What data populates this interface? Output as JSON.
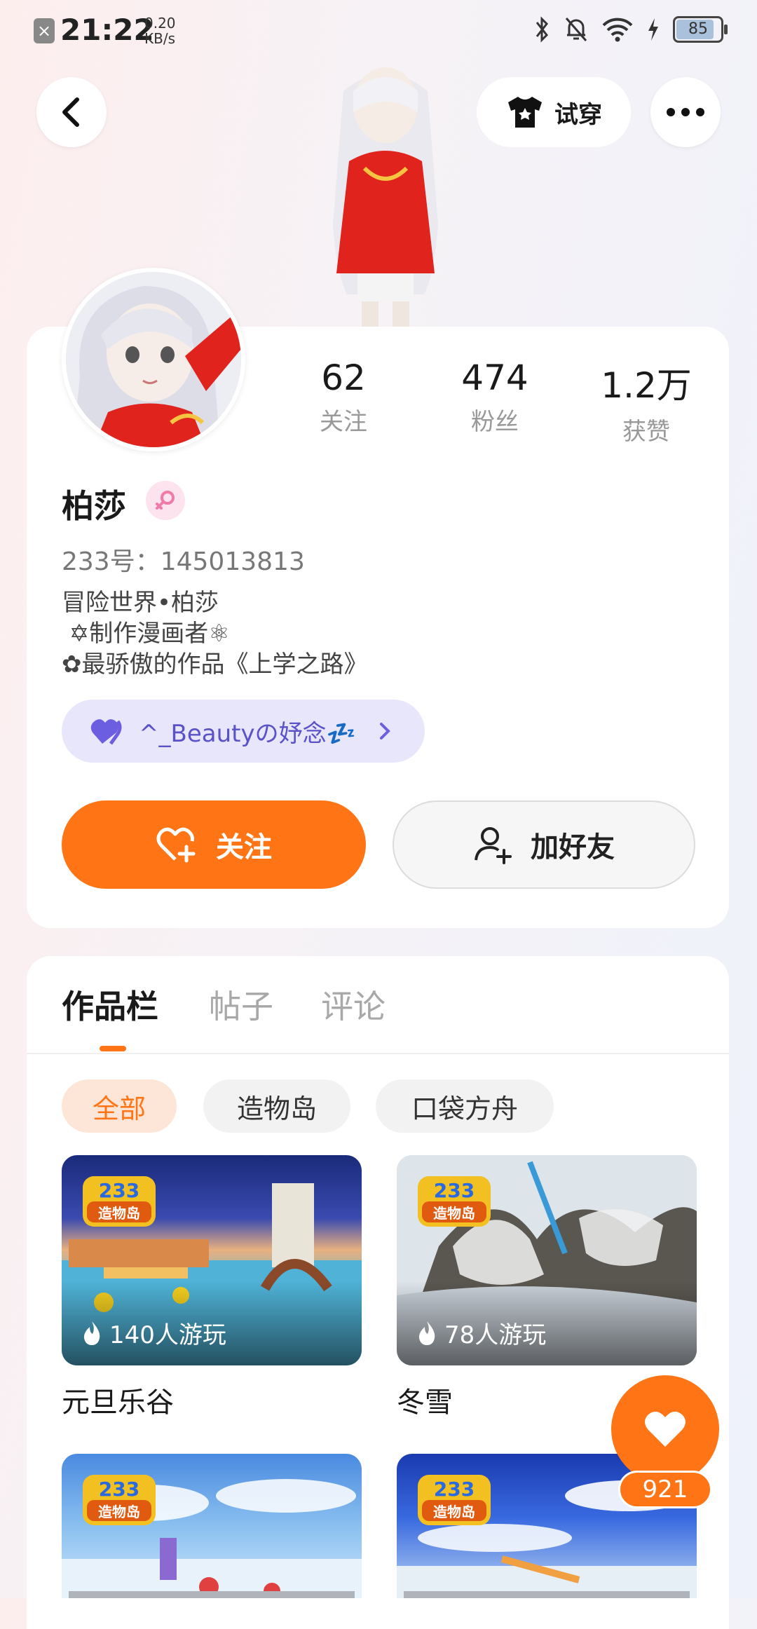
{
  "status_bar": {
    "time": "21:22",
    "net_rate_value": "0.20",
    "net_rate_unit": "KB/s",
    "battery": "85"
  },
  "header": {
    "try_on_label": "试穿"
  },
  "profile": {
    "stats": [
      {
        "value": "62",
        "label": "关注"
      },
      {
        "value": "474",
        "label": "粉丝"
      },
      {
        "value": "1.2万",
        "label": "获赞"
      }
    ],
    "name": "柏莎",
    "id_text": "233号：145013813",
    "bio_lines": [
      "冒险世界•柏莎",
      " ✡制作漫画者⚛",
      "✿最骄傲的作品《上学之路》"
    ],
    "family_text": "^_Beautyの妤念💤",
    "follow_label": "关注",
    "add_friend_label": "加好友"
  },
  "tabs": [
    "作品栏",
    "帖子",
    "评论"
  ],
  "filters": [
    "全部",
    "造物岛",
    "口袋方舟"
  ],
  "games": [
    {
      "title": "元旦乐谷",
      "plays": "140人游玩",
      "badge": "233造物岛"
    },
    {
      "title": "冬雪",
      "plays": "78人游玩",
      "badge": "233造物岛"
    },
    {
      "title": "",
      "plays": "",
      "badge": "233造物岛"
    },
    {
      "title": "",
      "plays": "",
      "badge": "233造物岛"
    }
  ],
  "like_fab": {
    "count": "921"
  },
  "colors": {
    "accent": "#ff7516",
    "family_bg": "#e8e6fb",
    "family_text": "#5a52c8"
  }
}
